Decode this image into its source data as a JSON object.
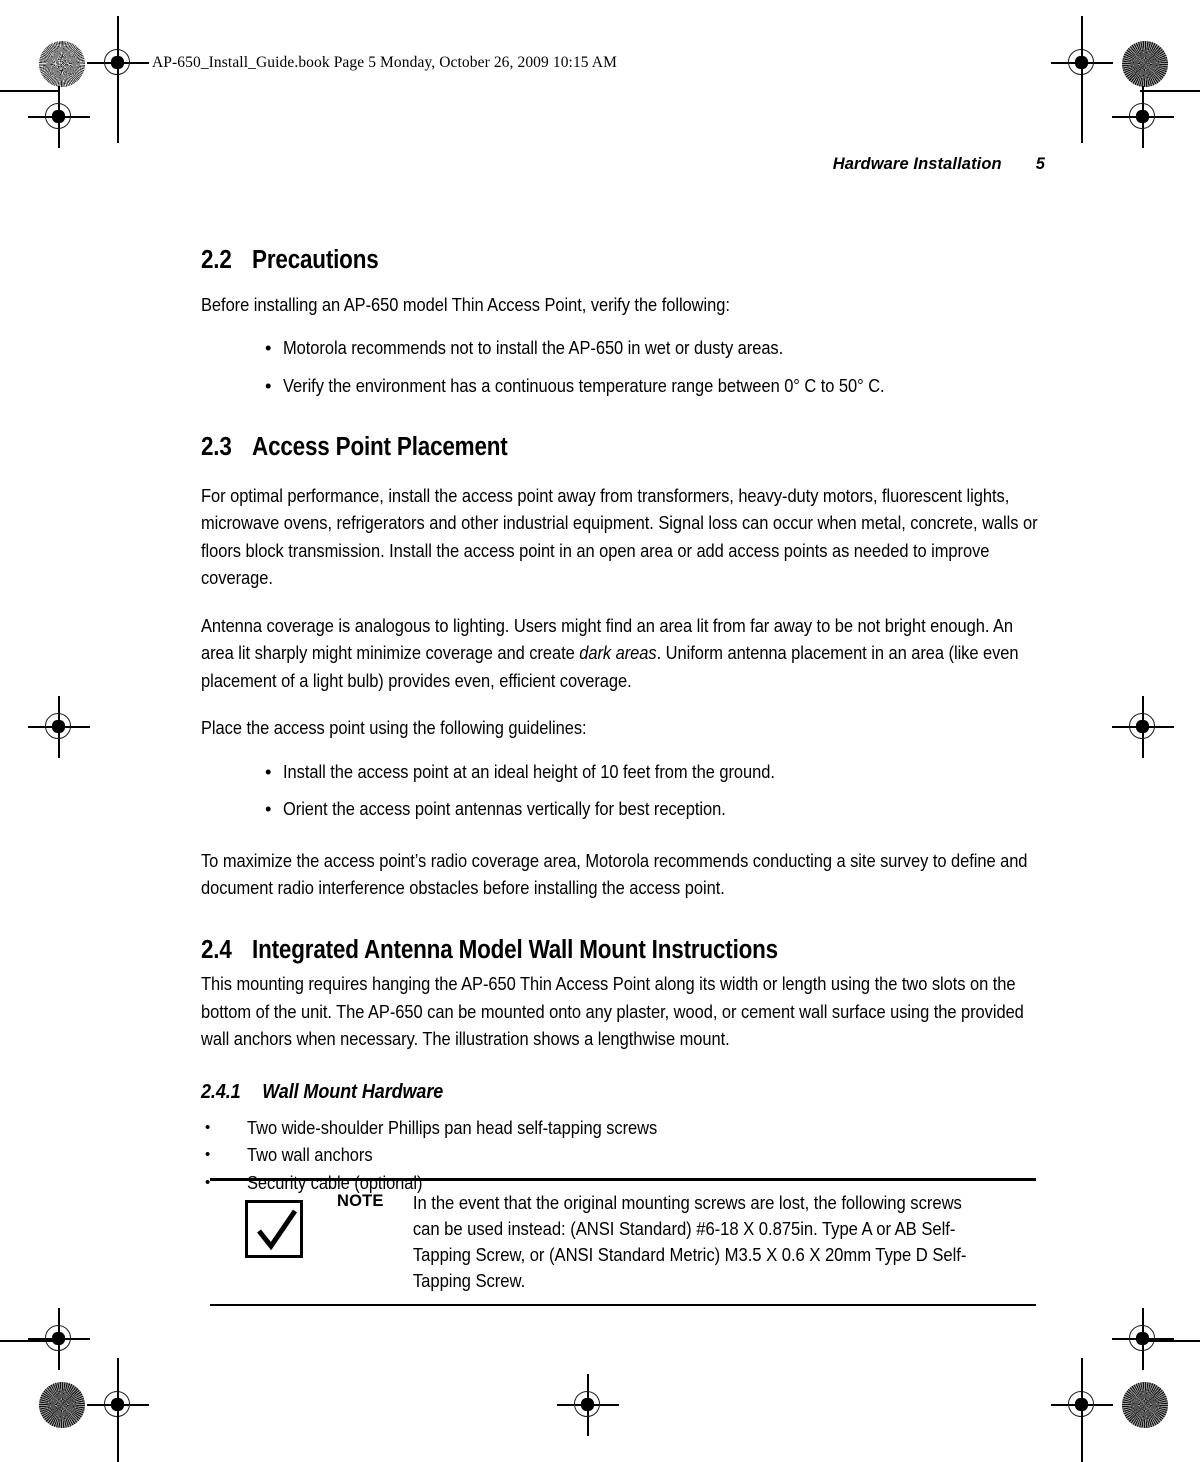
{
  "page": {
    "file_line": "AP-650_Install_Guide.book  Page 5  Monday, October 26, 2009  10:15 AM",
    "running_head_title": "Hardware Installation",
    "page_number": "5"
  },
  "sections": [
    {
      "number": "2.2",
      "title": "Precautions",
      "intro": "Before installing an AP-650 model Thin Access Point, verify the following:",
      "bullets": [
        "Motorola recommends not to install the AP-650 in wet or dusty areas.",
        "Verify the environment has a continuous temperature range between 0° C to 50° C."
      ]
    },
    {
      "number": "2.3",
      "title": "Access Point Placement",
      "para1": "For optimal performance, install the access point away from transformers, heavy-duty motors, fluorescent lights, microwave ovens, refrigerators and other industrial equipment. Signal loss can occur when metal, concrete, walls or floors block transmission. Install the access point in an open area or add access points as needed to improve coverage.",
      "para2_a": "Antenna coverage is analogous to lighting. Users might find an area lit from far away to be not bright enough. An area lit sharply might minimize coverage and create ",
      "para2_em": "dark areas",
      "para2_b": ". Uniform antenna placement in an area (like even placement of a light bulb) provides even, efficient coverage.",
      "para3": "Place the access point using the following guidelines:",
      "bullets": [
        "Install the access point at an ideal height of 10 feet from the ground.",
        "Orient the access point antennas vertically for best reception."
      ],
      "para4": "To maximize the access point’s radio coverage area, Motorola recommends conducting a site survey to define and document radio interference obstacles before installing the access point."
    },
    {
      "number": "2.4",
      "title": "Integrated Antenna Model Wall Mount Instructions",
      "para1": "This mounting requires hanging the AP-650 Thin Access Point along its width or length using the two slots on the bottom of the unit. The AP-650 can be mounted onto any plaster, wood, or cement wall surface using the provided wall anchors when necessary. The illustration shows a lengthwise mount."
    }
  ],
  "subsection": {
    "number": "2.4.1",
    "title": "Wall Mount Hardware",
    "bullets": [
      "Two wide-shoulder Phillips pan head self-tapping screws",
      "Two wall anchors",
      "Security cable (optional)"
    ]
  },
  "note": {
    "label": "NOTE",
    "icon": "checkmark-box-icon",
    "text": "In the event that the original mounting screws are lost, the following screws can be used instead: (ANSI Standard) #6-18 X 0.875in. Type A or AB Self-Tapping Screw, or (ANSI Standard Metric) M3.5 X 0.6 X 20mm Type D Self-Tapping Screw."
  },
  "bullet_glyph": "•",
  "colors": {
    "text": "#000000",
    "background": "#ffffff",
    "rule": "#000000"
  }
}
